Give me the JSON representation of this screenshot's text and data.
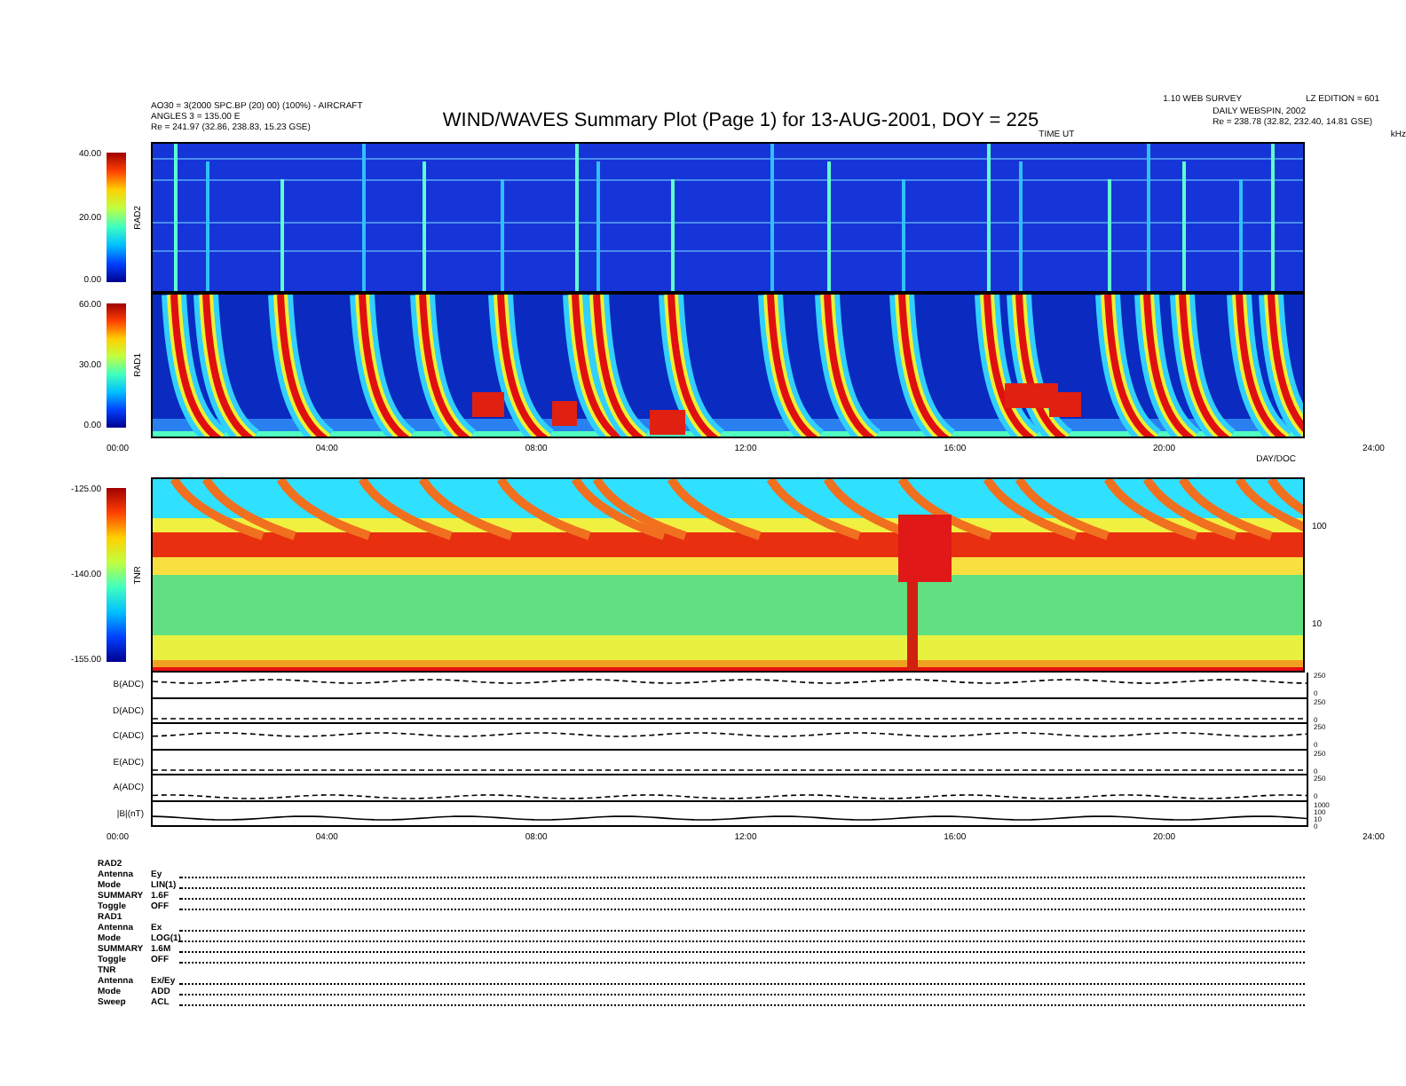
{
  "header": {
    "left_lines": [
      "AO30 = 3(2000 SPC.BP (20) 00) (100%) - AIRCRAFT",
      "ANGLES 3 = 135.00 E",
      "Re = 241.97 (32.86, 238.83, 15.23 GSE)"
    ],
    "title": "WIND/WAVES Summary Plot (Page 1) for 13-AUG-2001, DOY = 225",
    "right_top": [
      "1.10 WEB SURVEY",
      "LZ EDITION = 601"
    ],
    "right_lines": [
      "DAILY WEBSPIN, 2002",
      "Re = 238.78 (32.82, 232.40, 14.81 GSE)"
    ],
    "axis_note": "TIME UT",
    "unit": "kHz"
  },
  "panels": [
    {
      "name": "RAD2",
      "kind": "rad2",
      "colorbar_ticks": [
        "40.00",
        "20.00",
        "0.00"
      ]
    },
    {
      "name": "RAD1",
      "kind": "rad1",
      "colorbar_ticks": [
        "60.00",
        "30.00",
        "0.00"
      ]
    }
  ],
  "time_axis_1": {
    "labels": [
      "00:00",
      "04:00",
      "08:00",
      "12:00",
      "16:00",
      "20:00",
      "24:00"
    ],
    "title": "DAY/DOC"
  },
  "tnr": {
    "name": "TNR",
    "kind": "tnr",
    "colorbar_ticks": [
      "-125.00",
      "-140.00",
      "-155.00"
    ],
    "right_ticks": [
      "100",
      "10"
    ]
  },
  "strips": [
    {
      "label": "B(ADC)",
      "ticks": [
        "250",
        "0"
      ]
    },
    {
      "label": "D(ADC)",
      "ticks": [
        "250",
        "0"
      ]
    },
    {
      "label": "C(ADC)",
      "ticks": [
        "250",
        "0"
      ]
    },
    {
      "label": "E(ADC)",
      "ticks": [
        "250",
        "0"
      ]
    },
    {
      "label": "A(ADC)",
      "ticks": [
        "250",
        "0"
      ]
    },
    {
      "label": "|B|(nT)",
      "ticks": [
        "1000",
        "100",
        "10",
        "0"
      ]
    }
  ],
  "time_axis_2": {
    "labels": [
      "00:00",
      "04:00",
      "08:00",
      "12:00",
      "16:00",
      "20:00",
      "24:00"
    ]
  },
  "info": [
    {
      "title": "RAD2",
      "rows": [
        {
          "key": "Antenna",
          "value": "Ey"
        },
        {
          "key": "Mode",
          "value": "LIN(1)"
        },
        {
          "key": "SUMMARY",
          "value": "1.6F"
        },
        {
          "key": "Toggle",
          "value": "OFF"
        }
      ]
    },
    {
      "title": "RAD1",
      "rows": [
        {
          "key": "Antenna",
          "value": "Ex"
        },
        {
          "key": "Mode",
          "value": "LOG(1)"
        },
        {
          "key": "SUMMARY",
          "value": "1.6M"
        },
        {
          "key": "Toggle",
          "value": "OFF"
        }
      ]
    },
    {
      "title": "TNR",
      "rows": [
        {
          "key": "Antenna",
          "value": "Ex/Ey"
        },
        {
          "key": "Mode",
          "value": "ADD"
        },
        {
          "key": "Sweep",
          "value": "ACL"
        }
      ]
    }
  ]
}
